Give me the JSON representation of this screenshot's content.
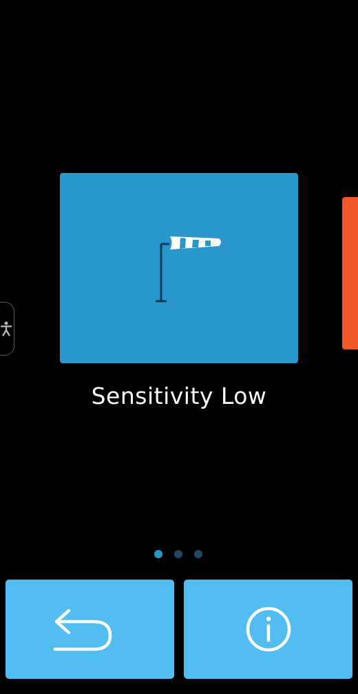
{
  "colors": {
    "background": "#000000",
    "card": "#2996cc",
    "windsock_stripes": "#ffffff",
    "windsock_pole": "#0e3a55",
    "next_card": "#f05a28",
    "button": "#52bdf1",
    "dot_active": "#2996cc",
    "dot_inactive": "#1d4a66",
    "a11y_icon": "#bdbdbd"
  },
  "carousel": {
    "current_card": {
      "icon": "windsock-icon",
      "label": "Sensitivity Low"
    },
    "next_card_icon": "orange-card",
    "pages": [
      {
        "active": true
      },
      {
        "active": false
      },
      {
        "active": false
      }
    ]
  },
  "accessibility_tab": {
    "icon": "accessibility-icon"
  },
  "buttons": {
    "back": {
      "icon": "back-arrow-icon"
    },
    "info": {
      "icon": "info-icon"
    }
  }
}
